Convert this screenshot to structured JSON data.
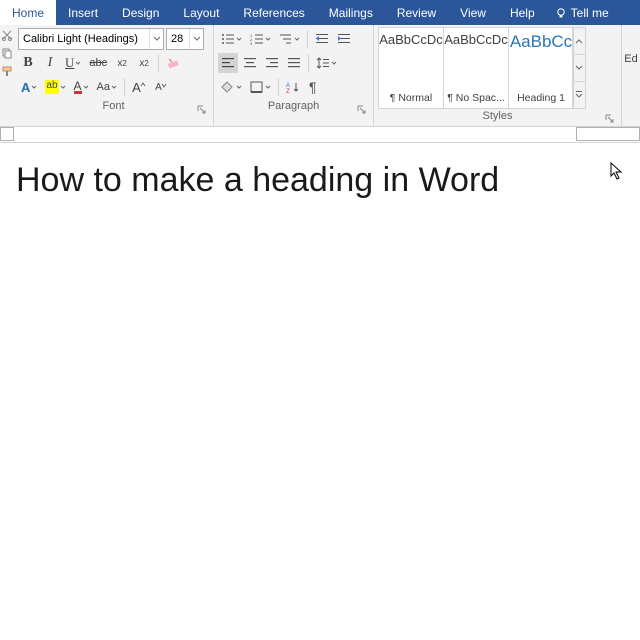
{
  "tabs": {
    "items": [
      "Home",
      "Insert",
      "Design",
      "Layout",
      "References",
      "Mailings",
      "Review",
      "View",
      "Help"
    ],
    "active": "Home",
    "tellme": "Tell me"
  },
  "font": {
    "group_label": "Font",
    "name": "Calibri Light (Headings)",
    "size": "28",
    "bold": "B",
    "italic": "I",
    "underline": "U",
    "strike": "abc",
    "subscript": "x",
    "sub_small": "2",
    "superscript": "x",
    "sup_small": "2",
    "text_effects": "A",
    "highlight": "ab",
    "font_color": "A",
    "change_case": "Aa",
    "grow": "A",
    "shrink": "A"
  },
  "paragraph": {
    "group_label": "Paragraph"
  },
  "styles": {
    "group_label": "Styles",
    "preview": "AaBbCcDc",
    "preview_h1": "AaBbCc",
    "items": [
      "¶ Normal",
      "¶ No Spac...",
      "Heading 1"
    ]
  },
  "editing": {
    "label": "Ed"
  },
  "document": {
    "heading": "How to make a heading in Word"
  }
}
